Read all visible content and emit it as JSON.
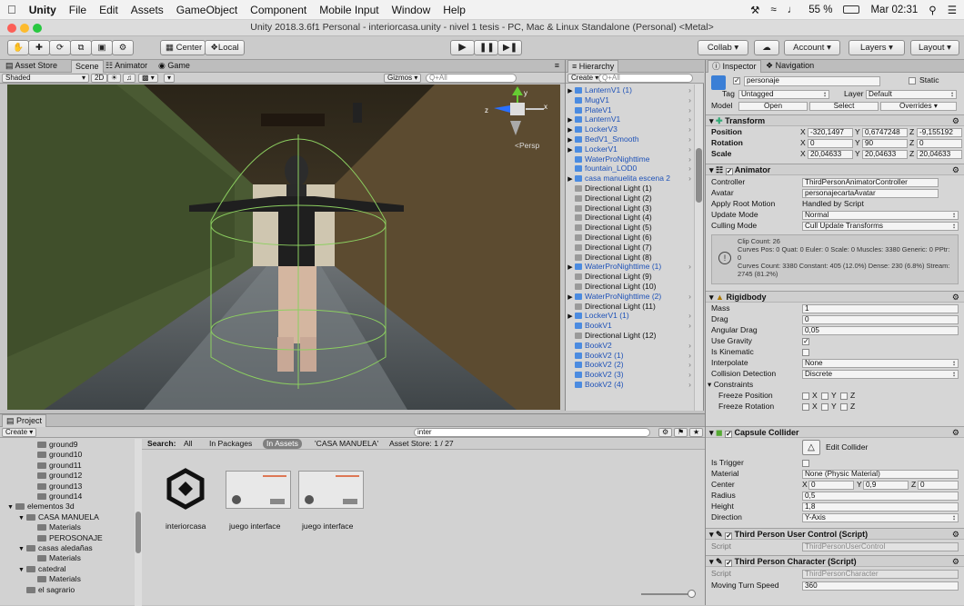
{
  "menubar": {
    "app": "Unity",
    "items": [
      "File",
      "Edit",
      "Assets",
      "GameObject",
      "Component",
      "Mobile Input",
      "Window",
      "Help"
    ],
    "battery": "55 %",
    "clock": "Mar 02:31"
  },
  "window": {
    "title": "Unity 2018.3.6f1 Personal - interiorcasa.unity - nivel 1 tesis - PC, Mac & Linux Standalone (Personal) <Metal>"
  },
  "toolbar": {
    "center": "Center",
    "local": "Local",
    "collab": "Collab",
    "account": "Account",
    "layers": "Layers",
    "layout": "Layout"
  },
  "scene_panel": {
    "tabs": [
      "Asset Store",
      "Scene",
      "Animator",
      "Game"
    ],
    "shading": "Shaded",
    "mode2d": "2D",
    "gizmos": "Gizmos",
    "search_placeholder": "Q+All",
    "persp": "Persp",
    "axis_x": "x",
    "axis_y": "y",
    "axis_z": "z"
  },
  "hierarchy": {
    "title": "Hierarchy",
    "create": "Create",
    "search_placeholder": "Q+All",
    "items": [
      {
        "name": "LanternV1 (1)",
        "type": "prefab"
      },
      {
        "name": "MugV1",
        "type": "prefab"
      },
      {
        "name": "PlateV1",
        "type": "prefab"
      },
      {
        "name": "LanternV1",
        "type": "prefab"
      },
      {
        "name": "LockerV3",
        "type": "prefab"
      },
      {
        "name": "BedV1_Smooth",
        "type": "prefab"
      },
      {
        "name": "LockerV1",
        "type": "prefab"
      },
      {
        "name": "WaterProNighttime",
        "type": "prefab"
      },
      {
        "name": "fountain_LOD0",
        "type": "prefab"
      },
      {
        "name": "casa manuelita escena 2",
        "type": "prefab"
      },
      {
        "name": "Directional Light (1)",
        "type": "object"
      },
      {
        "name": "Directional Light (2)",
        "type": "object"
      },
      {
        "name": "Directional Light (3)",
        "type": "object"
      },
      {
        "name": "Directional Light (4)",
        "type": "object"
      },
      {
        "name": "Directional Light (5)",
        "type": "object"
      },
      {
        "name": "Directional Light (6)",
        "type": "object"
      },
      {
        "name": "Directional Light (7)",
        "type": "object"
      },
      {
        "name": "Directional Light (8)",
        "type": "object"
      },
      {
        "name": "WaterProNighttime (1)",
        "type": "prefab"
      },
      {
        "name": "Directional Light (9)",
        "type": "object"
      },
      {
        "name": "Directional Light (10)",
        "type": "object"
      },
      {
        "name": "WaterProNighttime (2)",
        "type": "prefab"
      },
      {
        "name": "Directional Light (11)",
        "type": "object"
      },
      {
        "name": "LockerV1 (1)",
        "type": "prefab"
      },
      {
        "name": "BookV1",
        "type": "prefab"
      },
      {
        "name": "Directional Light (12)",
        "type": "object"
      },
      {
        "name": "BookV2",
        "type": "prefab"
      },
      {
        "name": "BookV2 (1)",
        "type": "prefab"
      },
      {
        "name": "BookV2 (2)",
        "type": "prefab"
      },
      {
        "name": "BookV2 (3)",
        "type": "prefab"
      },
      {
        "name": "BookV2 (4)",
        "type": "prefab"
      }
    ]
  },
  "inspector": {
    "tabs": [
      "Inspector",
      "Navigation"
    ],
    "object_name": "personaje",
    "static": "Static",
    "tag_label": "Tag",
    "tag": "Untagged",
    "layer_label": "Layer",
    "layer": "Default",
    "model_label": "Model",
    "open": "Open",
    "select": "Select",
    "overrides": "Overrides",
    "transform": {
      "title": "Transform",
      "position_label": "Position",
      "rotation_label": "Rotation",
      "scale_label": "Scale",
      "px": "-320,1497",
      "py": "0,6747248",
      "pz": "-9,155192",
      "rx": "0",
      "ry": "90",
      "rz": "0",
      "sx": "20,04633",
      "sy": "20,04633",
      "sz": "20,04633"
    },
    "animator": {
      "title": "Animator",
      "controller_label": "Controller",
      "controller": "ThirdPersonAnimatorController",
      "avatar_label": "Avatar",
      "avatar": "personajecartaAvatar",
      "root_motion_label": "Apply Root Motion",
      "root_motion": "Handled by Script",
      "update_label": "Update Mode",
      "update": "Normal",
      "culling_label": "Culling Mode",
      "culling": "Cull Update Transforms",
      "info1": "Clip Count: 26",
      "info2": "Curves Pos: 0 Quat: 0 Euler: 0 Scale: 0 Muscles: 3380 Generic: 0 PPtr: 0",
      "info3": "Curves Count: 3380 Constant: 405 (12.0%) Dense: 230 (6.8%) Stream: 2745 (81.2%)"
    },
    "rigidbody": {
      "title": "Rigidbody",
      "mass_label": "Mass",
      "mass": "1",
      "drag_label": "Drag",
      "drag": "0",
      "angular_label": "Angular Drag",
      "angular": "0,05",
      "gravity_label": "Use Gravity",
      "kinematic_label": "Is Kinematic",
      "interpolate_label": "Interpolate",
      "interpolate": "None",
      "collision_label": "Collision Detection",
      "collision": "Discrete",
      "constraints_label": "Constraints",
      "freeze_pos_label": "Freeze Position",
      "freeze_rot_label": "Freeze Rotation",
      "x": "X",
      "y": "Y",
      "z": "Z"
    },
    "collider": {
      "title": "Capsule Collider",
      "edit": "Edit Collider",
      "trigger_label": "Is Trigger",
      "material_label": "Material",
      "material": "None (Physic Material)",
      "center_label": "Center",
      "cx": "0",
      "cy": "0,9",
      "cz": "0",
      "radius_label": "Radius",
      "radius": "0,5",
      "height_label": "Height",
      "height": "1,8",
      "direction_label": "Direction",
      "direction": "Y-Axis"
    },
    "script1": {
      "title": "Third Person User Control (Script)",
      "label": "Script",
      "value": "ThirdPersonUserControl"
    },
    "script2": {
      "title": "Third Person Character (Script)",
      "label": "Script",
      "value": "ThirdPersonCharacter"
    },
    "turn_label": "Moving Turn Speed",
    "turn": "360"
  },
  "project": {
    "title": "Project",
    "create": "Create",
    "search_value": "inter",
    "search_label": "Search:",
    "filters": [
      "All",
      "In Packages",
      "In Assets",
      "'CASA MANUELA'",
      "Asset Store: 1 / 27"
    ],
    "tree": [
      {
        "name": "ground9",
        "indent": 3
      },
      {
        "name": "ground10",
        "indent": 3
      },
      {
        "name": "ground11",
        "indent": 3
      },
      {
        "name": "ground12",
        "indent": 3
      },
      {
        "name": "ground13",
        "indent": 3
      },
      {
        "name": "ground14",
        "indent": 3
      },
      {
        "name": "elementos 3d",
        "indent": 1
      },
      {
        "name": "CASA MANUELA",
        "indent": 2
      },
      {
        "name": "Materials",
        "indent": 3
      },
      {
        "name": "PEROSONAJE",
        "indent": 3
      },
      {
        "name": "casas aledañas",
        "indent": 2
      },
      {
        "name": "Materials",
        "indent": 3
      },
      {
        "name": "catedral",
        "indent": 2
      },
      {
        "name": "Materials",
        "indent": 3
      },
      {
        "name": "el sagrario",
        "indent": 2
      }
    ],
    "assets": [
      "interiorcasa",
      "juego interface",
      "juego interface"
    ]
  }
}
